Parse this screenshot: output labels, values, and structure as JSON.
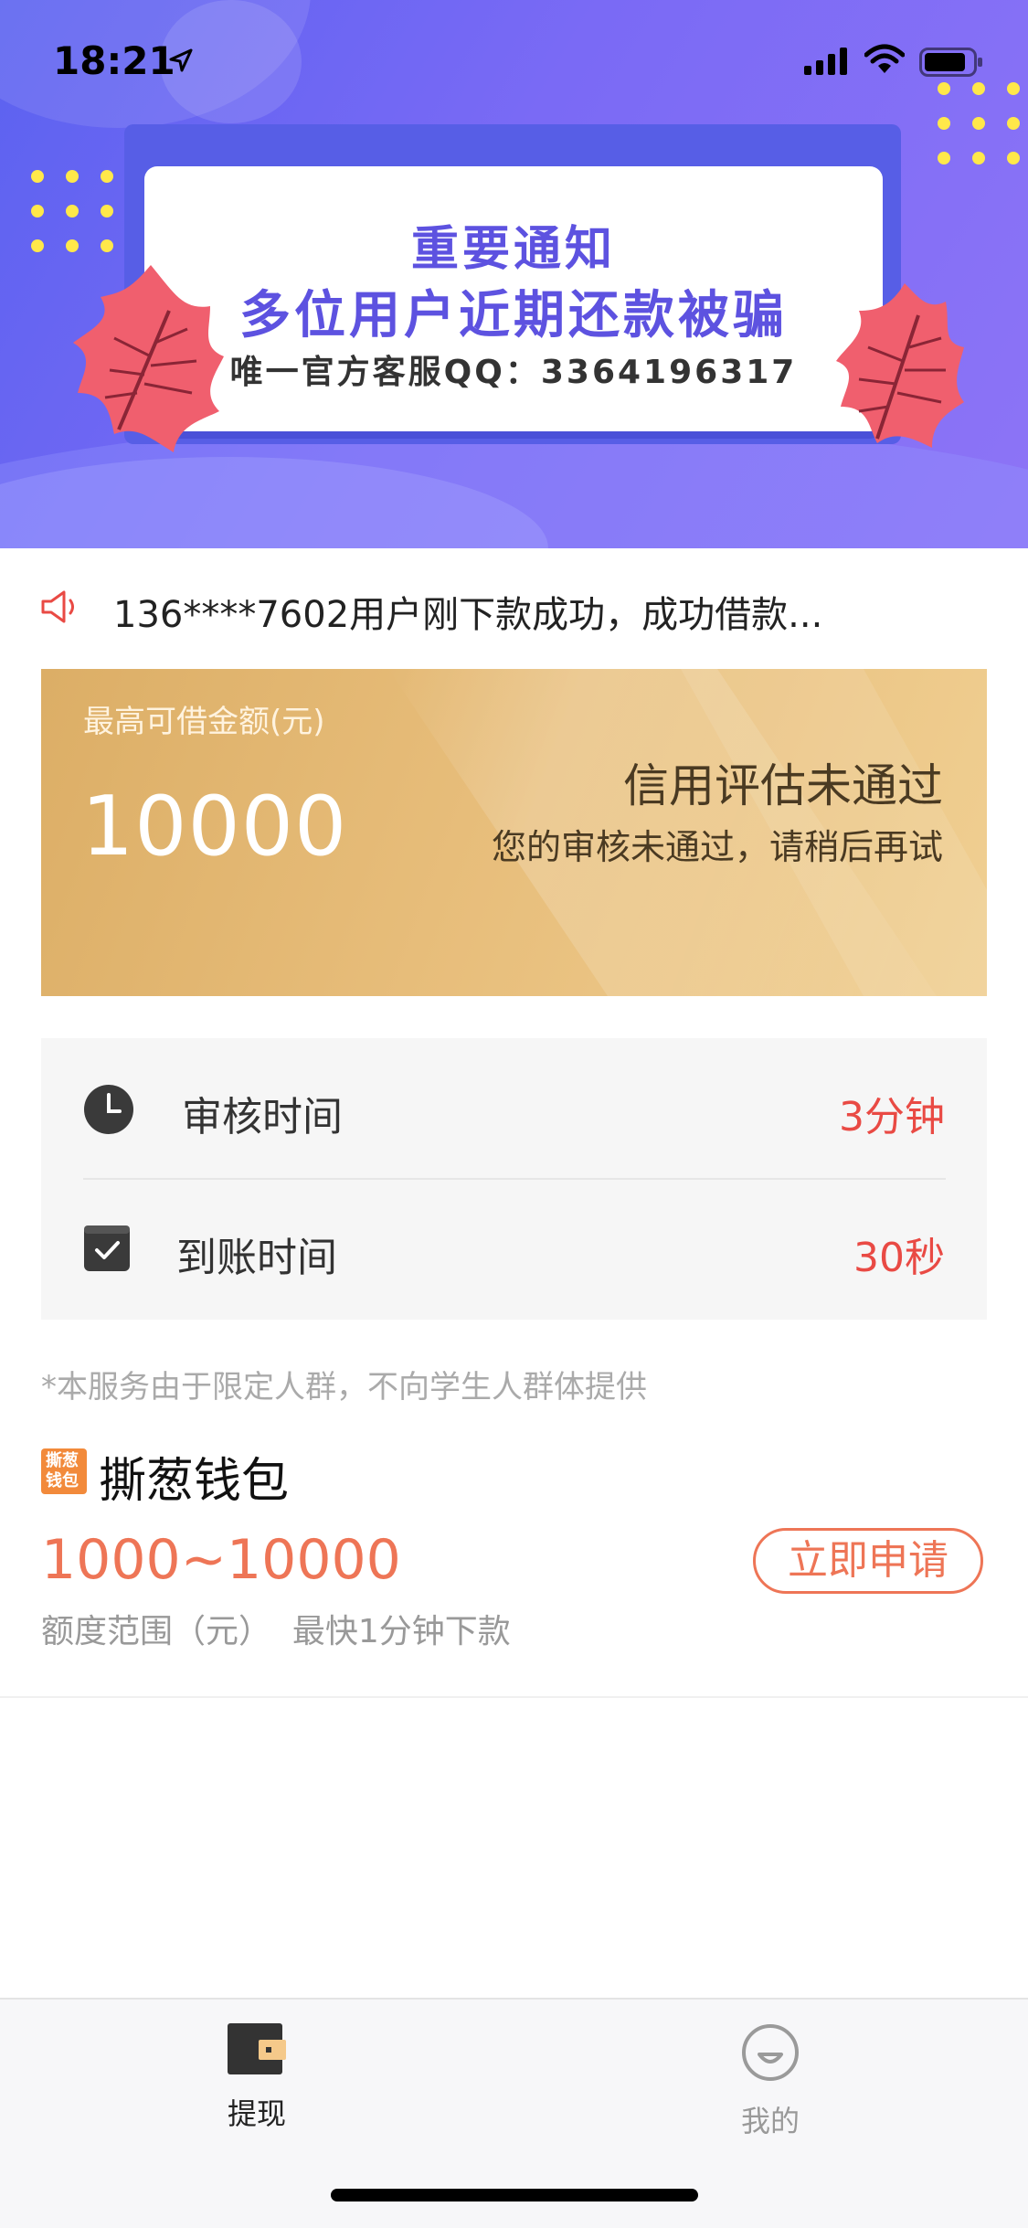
{
  "status_bar": {
    "time": "18:21",
    "icons": [
      "location-arrow-icon",
      "signal-icon",
      "wifi-icon",
      "battery-icon"
    ]
  },
  "banner": {
    "title": "重要通知",
    "headline": "多位用户近期还款被骗",
    "contact": "唯一官方客服QQ：3364196317"
  },
  "ticker": {
    "icon": "speaker-icon",
    "text": "136****7602用户刚下款成功，成功借款..."
  },
  "credit_card": {
    "label": "最高可借金额(元)",
    "amount": "10000",
    "status": "信用评估未通过",
    "status_detail": "您的审核未通过，请稍后再试"
  },
  "info": [
    {
      "icon": "clock-icon",
      "label": "审核时间",
      "value": "3分钟"
    },
    {
      "icon": "calendar-check-icon",
      "label": "到账时间",
      "value": "30秒"
    }
  ],
  "notice": "*本服务由于限定人群，不向学生人群体提供",
  "product": {
    "logo_text": [
      "撕葱",
      "钱包"
    ],
    "name": "撕葱钱包",
    "range": "1000~10000",
    "desc": "额度范围（元）  最快1分钟下款",
    "apply_label": "立即申请"
  },
  "tabbar": {
    "items": [
      {
        "icon": "wallet-icon",
        "label": "提现",
        "active": true
      },
      {
        "icon": "smiley-icon",
        "label": "我的",
        "active": false
      }
    ]
  },
  "colors": {
    "banner": "#6b66f2",
    "card_gold": "#e2b46e",
    "accent_red": "#e94a44",
    "accent_orange": "#ee7556"
  }
}
